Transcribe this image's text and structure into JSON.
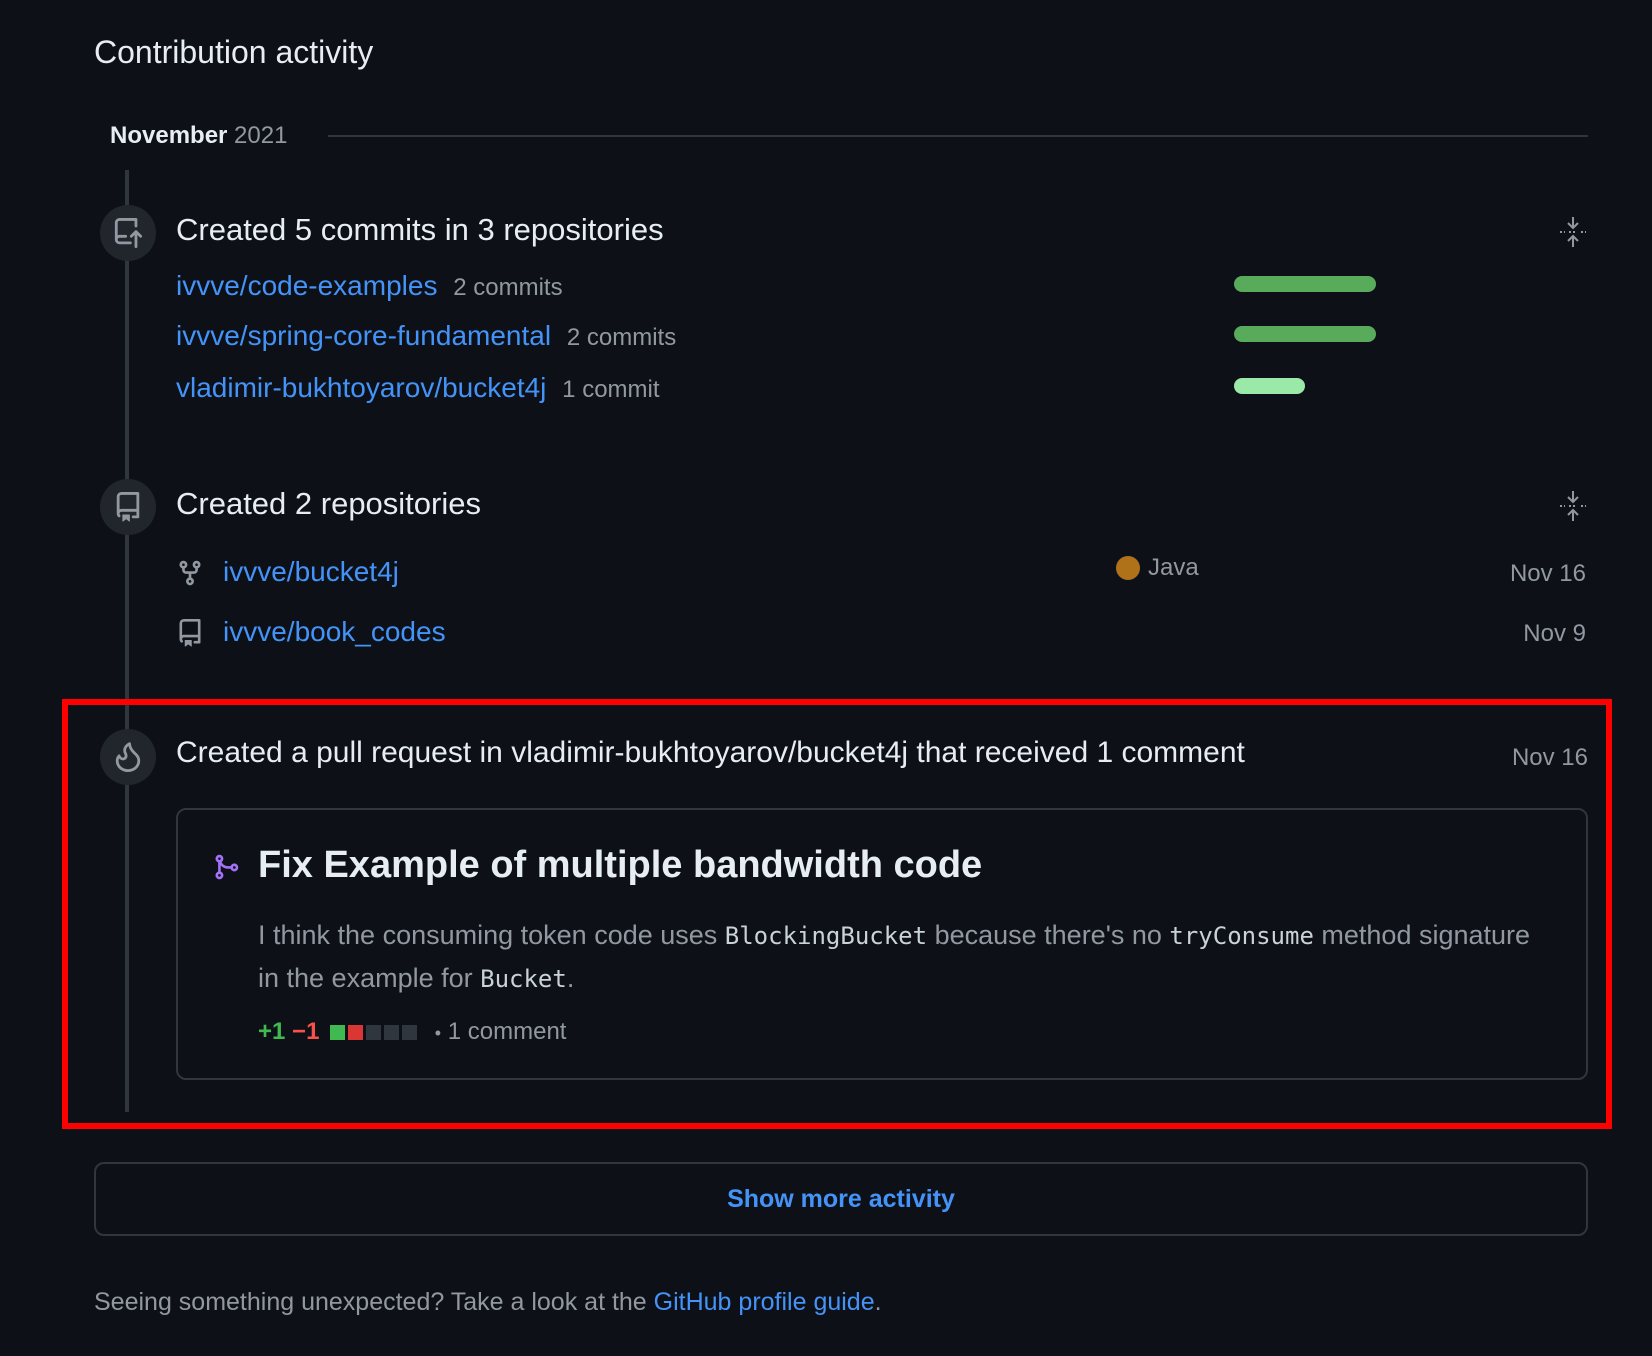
{
  "section_title": "Contribution activity",
  "month": {
    "name": "November",
    "year": "2021"
  },
  "commits": {
    "title": "Created 5 commits in 3 repositories",
    "repos": [
      {
        "name": "ivvve/code-examples",
        "count": "2 commits",
        "share": 1.0
      },
      {
        "name": "ivvve/spring-core-fundamental",
        "count": "2 commits",
        "share": 1.0
      },
      {
        "name": "vladimir-bukhtoyarov/bucket4j",
        "count": "1 commit",
        "share": 0.5
      }
    ]
  },
  "created_repos": {
    "title": "Created 2 repositories",
    "repos": [
      {
        "name": "ivvve/bucket4j",
        "icon": "fork-icon",
        "language": "Java",
        "language_color": "#b07219",
        "date": "Nov 16"
      },
      {
        "name": "ivvve/book_codes",
        "icon": "repo-icon",
        "language": "",
        "date": "Nov 9"
      }
    ]
  },
  "pull_request": {
    "title": "Created a pull request in vladimir-bukhtoyarov/bucket4j that received 1 comment",
    "date": "Nov 16",
    "pr_title": "Fix Example of multiple bandwidth code",
    "body_1": "I think the consuming token code uses ",
    "code_1": "BlockingBucket",
    "body_2": " because there's no ",
    "code_2": "tryConsume",
    "body_3": " method signature in the example for ",
    "code_3": "Bucket",
    "body_4": ".",
    "additions": "+1",
    "deletions": "−1",
    "separator": "•",
    "comments": "1 comment"
  },
  "show_more": "Show more activity",
  "footer": {
    "text": "Seeing something unexpected? Take a look at the ",
    "link": "GitHub profile guide",
    "end": "."
  },
  "colors": {
    "background": "#0d1117",
    "link": "#4493f8",
    "bar_full": "#57ab5a",
    "bar_light": "#9be9a8",
    "added": "#3fb950",
    "deleted": "#f85149",
    "highlight_border": "#ff0000"
  }
}
